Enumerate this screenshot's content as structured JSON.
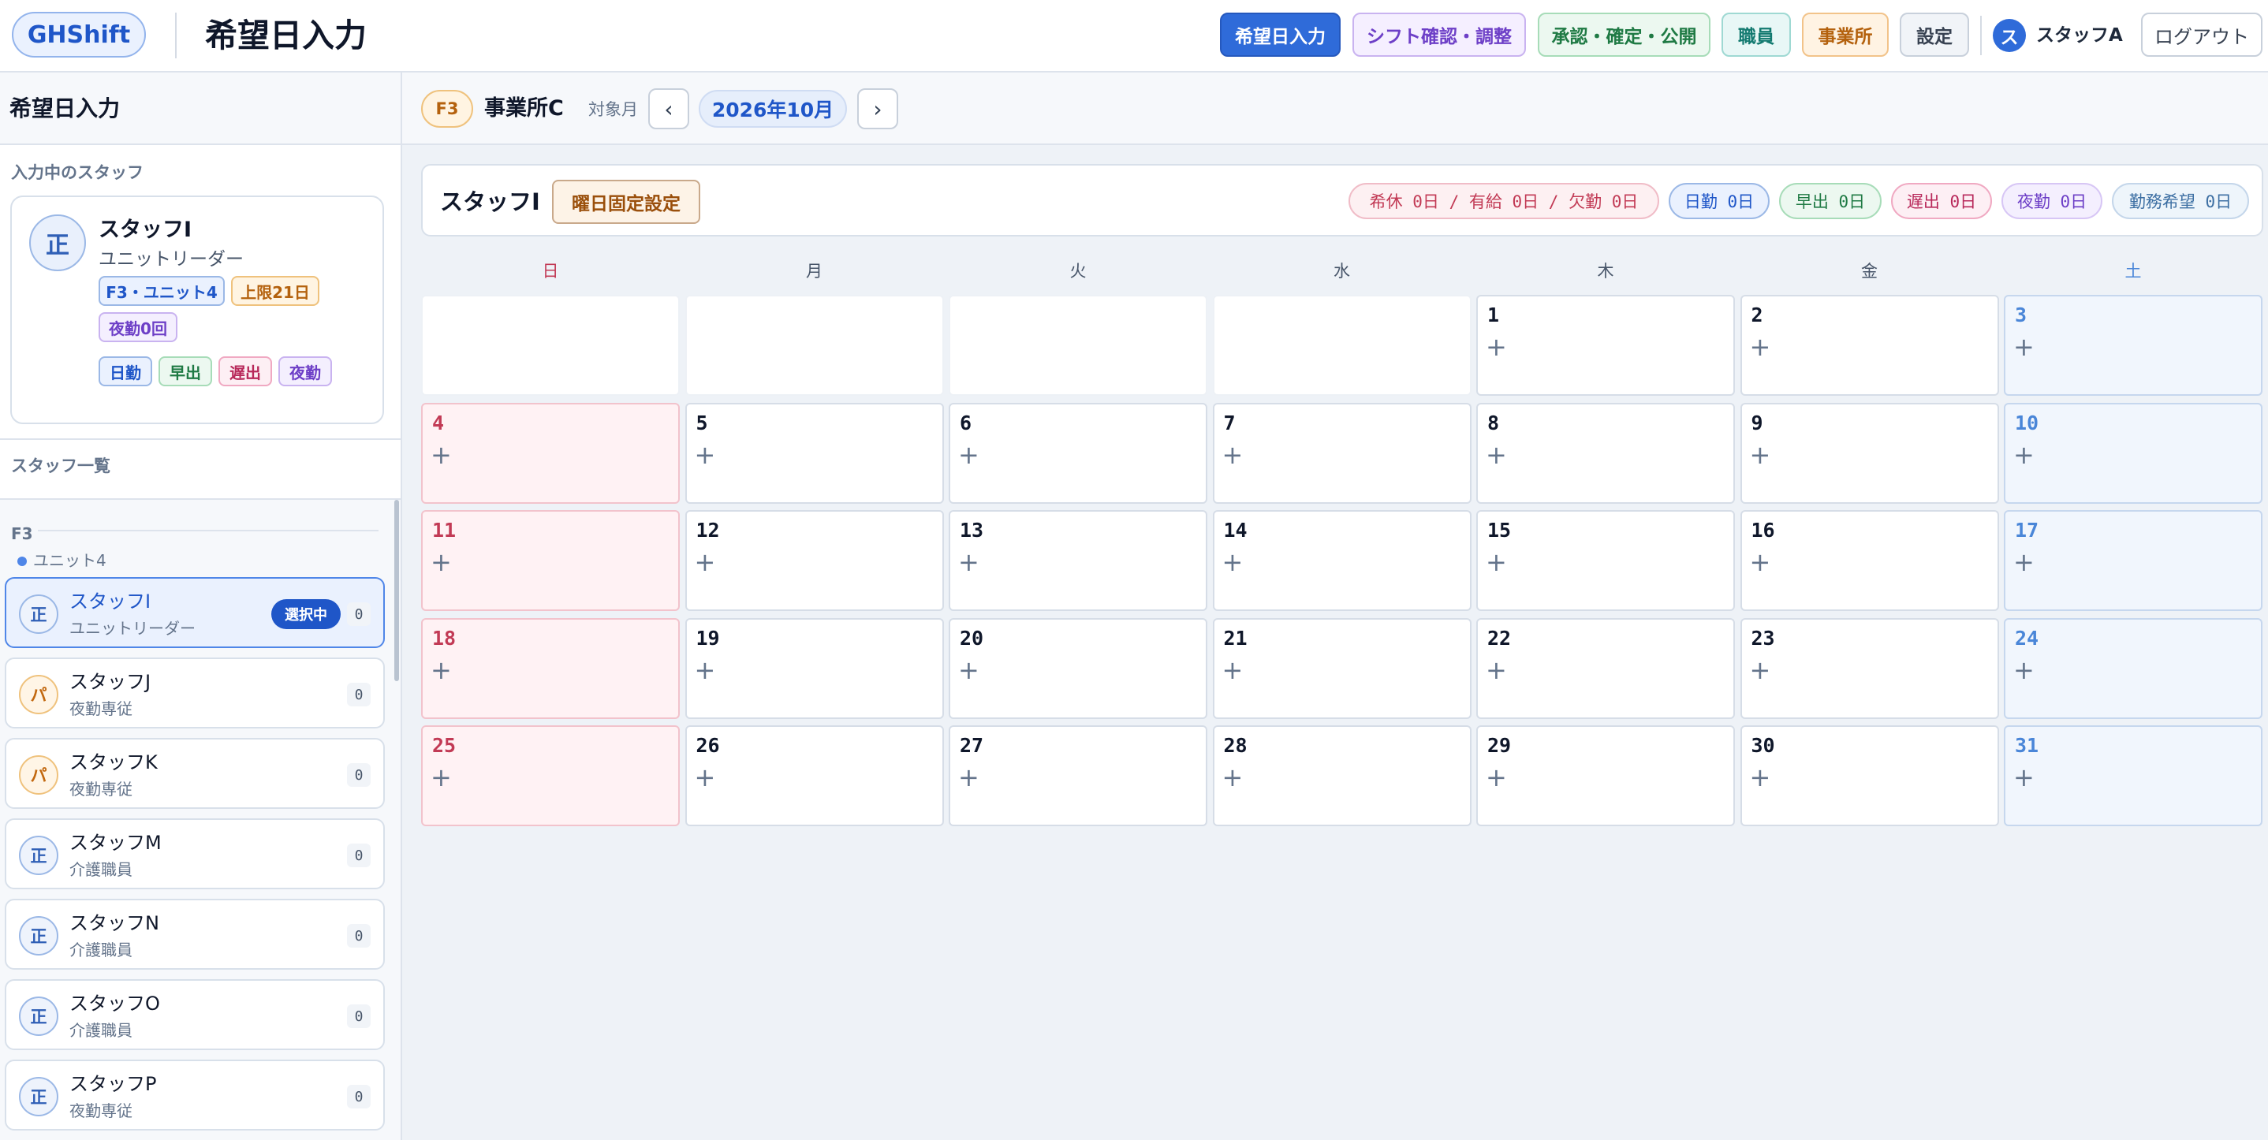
{
  "header": {
    "logo": "GHShift",
    "title": "希望日入力",
    "nav": {
      "hope": "希望日入力",
      "check": "シフト確認・調整",
      "approve": "承認・確定・公開",
      "staff": "職員",
      "office": "事業所",
      "settings": "設定"
    },
    "user_initial": "ス",
    "user_name": "スタッフA",
    "logout": "ログアウト"
  },
  "sidebar": {
    "title": "希望日入力",
    "current_label": "入力中のスタッフ",
    "current": {
      "avatar": "正",
      "name": "スタッフI",
      "role": "ユニットリーダー",
      "unit_tag": "F3・ユニット4",
      "limit_tag": "上限21日",
      "night_tag": "夜勤0回",
      "shift_types": [
        "日勤",
        "早出",
        "遅出",
        "夜勤"
      ]
    },
    "list_label": "スタッフ一覧",
    "group": "F3",
    "unit": "ユニット4",
    "selected_badge": "選択中",
    "staff": [
      {
        "avatar": "正",
        "name": "スタッフI",
        "role": "ユニットリーダー",
        "count": "0"
      },
      {
        "avatar": "パ",
        "name": "スタッフJ",
        "role": "夜勤専従",
        "count": "0"
      },
      {
        "avatar": "パ",
        "name": "スタッフK",
        "role": "夜勤専従",
        "count": "0"
      },
      {
        "avatar": "正",
        "name": "スタッフM",
        "role": "介護職員",
        "count": "0"
      },
      {
        "avatar": "正",
        "name": "スタッフN",
        "role": "介護職員",
        "count": "0"
      },
      {
        "avatar": "正",
        "name": "スタッフO",
        "role": "介護職員",
        "count": "0"
      },
      {
        "avatar": "正",
        "name": "スタッフP",
        "role": "夜勤専従",
        "count": "0"
      }
    ]
  },
  "topbar": {
    "floor": "F3",
    "office": "事業所C",
    "month_label": "対象月",
    "prev": "‹",
    "month": "2026年10月",
    "next": "›"
  },
  "summary": {
    "staff_name": "スタッフI",
    "fixed_button": "曜日固定設定",
    "off": "希休 0日 / 有給 0日 / 欠勤 0日",
    "day": "日勤 0日",
    "early": "早出 0日",
    "late": "遅出 0日",
    "night": "夜勤 0日",
    "wish": "勤務希望 0日"
  },
  "calendar": {
    "weekdays": [
      "日",
      "月",
      "火",
      "水",
      "木",
      "金",
      "土"
    ],
    "first_weekday_index": 4,
    "days_in_month": 31,
    "add_symbol": "+",
    "colors": {
      "sunday": "#c23a55",
      "saturday": "#4a86d8",
      "accent": "#2f6bd9"
    }
  }
}
